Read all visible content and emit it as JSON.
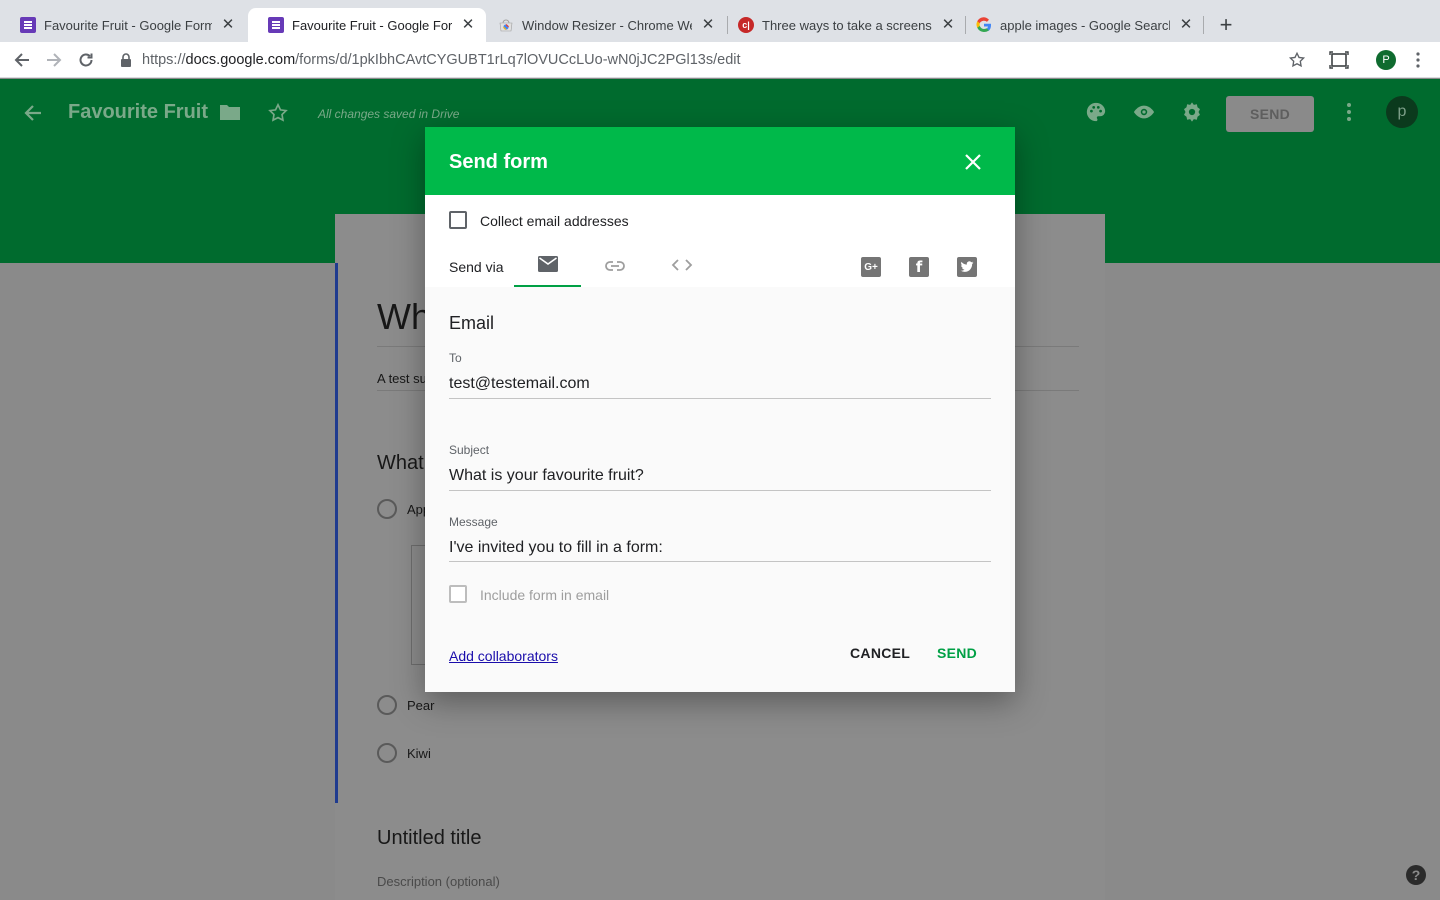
{
  "browser": {
    "tabs": [
      {
        "title": "Favourite Fruit - Google Forms",
        "icon": "forms-icon",
        "active": false
      },
      {
        "title": "Favourite Fruit - Google Forms",
        "icon": "forms-icon",
        "active": true
      },
      {
        "title": "Window Resizer - Chrome Web Store",
        "icon": "chrome-webstore-icon",
        "active": false
      },
      {
        "title": "Three ways to take a screenshot",
        "icon": "red-circle-icon",
        "active": false
      },
      {
        "title": "apple images - Google Search",
        "icon": "google-icon",
        "active": false
      }
    ],
    "red_favicon_text": "c|",
    "close_glyph": "✕",
    "new_tab_glyph": "+",
    "url_prefix": "https://",
    "url_host": "docs.google.com",
    "url_path": "/forms/d/1pkIbhCAvtCYGUBT1rLq7lOVUCcLUo-wN0jJC2PGl13s/edit",
    "profile_initial": "P"
  },
  "forms_header": {
    "title": "Favourite Fruit",
    "saved_status": "All changes saved in Drive",
    "send_label": "SEND",
    "avatar_initial": "p"
  },
  "form": {
    "title_partial": "Wh",
    "description_partial": "A test su",
    "question_partial": "What",
    "options": [
      "App",
      "Pear",
      "Kiwi"
    ],
    "untitled_title": "Untitled title",
    "description_placeholder": "Description (optional)"
  },
  "dialog": {
    "title": "Send form",
    "collect_email_label": "Collect email addresses",
    "collect_email_checked": false,
    "send_via_label": "Send via",
    "send_via_tabs": [
      "email-icon",
      "link-icon",
      "embed-icon"
    ],
    "active_tab": "email",
    "social": [
      "google-plus-icon",
      "facebook-icon",
      "twitter-icon"
    ],
    "social_glyphs": {
      "google_plus": "G+",
      "facebook": "f"
    },
    "section_title": "Email",
    "to_label": "To",
    "to_value": "test@testemail.com",
    "subject_label": "Subject",
    "subject_value": "What is your favourite fruit?",
    "message_label": "Message",
    "message_value": "I've invited you to fill in a form:",
    "include_form_label": "Include form in email",
    "include_form_checked": false,
    "add_collaborators": "Add collaborators",
    "cancel_label": "CANCEL",
    "send_label": "SEND"
  },
  "help_glyph": "?",
  "colors": {
    "dialog_header": "#00b94a",
    "send_button_text": "#00a045",
    "forms_header_dimmed": "#006b2e",
    "link": "#1a0dab"
  }
}
